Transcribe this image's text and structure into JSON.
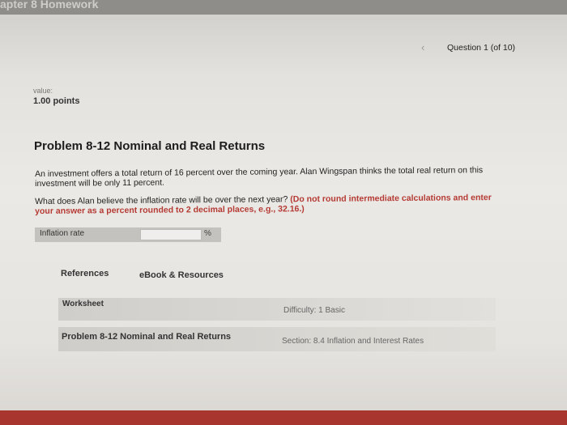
{
  "header": {
    "title": "apter 8 Homework"
  },
  "navigation": {
    "prev_icon": "chevron-left-icon",
    "question_label": "Question 1 (of 10)"
  },
  "question": {
    "value_label": "value:",
    "points": "1.00 points",
    "title": "Problem 8-12 Nominal and Real Returns",
    "paragraph1": "An investment offers a total return of 16 percent over the coming year. Alan Wingspan thinks the total real return on this investment will be only 11 percent.",
    "paragraph2_plain": "What does Alan believe the inflation rate will be over the next year?",
    "paragraph2_red": "(Do not round intermediate calculations and enter your answer as a percent rounded to 2 decimal places, e.g., 32.16.)"
  },
  "answer": {
    "label": "Inflation rate",
    "value": "",
    "unit": "%"
  },
  "references": {
    "label": "References",
    "ebook": "eBook & Resources"
  },
  "worksheet": {
    "label": "Worksheet",
    "difficulty": "Difficulty: 1 Basic"
  },
  "problem_info": {
    "name": "Problem 8-12 Nominal and Real Returns",
    "section": "Section: 8.4 Inflation and Interest Rates"
  },
  "colors": {
    "accent_red": "#b53a34",
    "bottom_stripe": "#a8362f"
  }
}
